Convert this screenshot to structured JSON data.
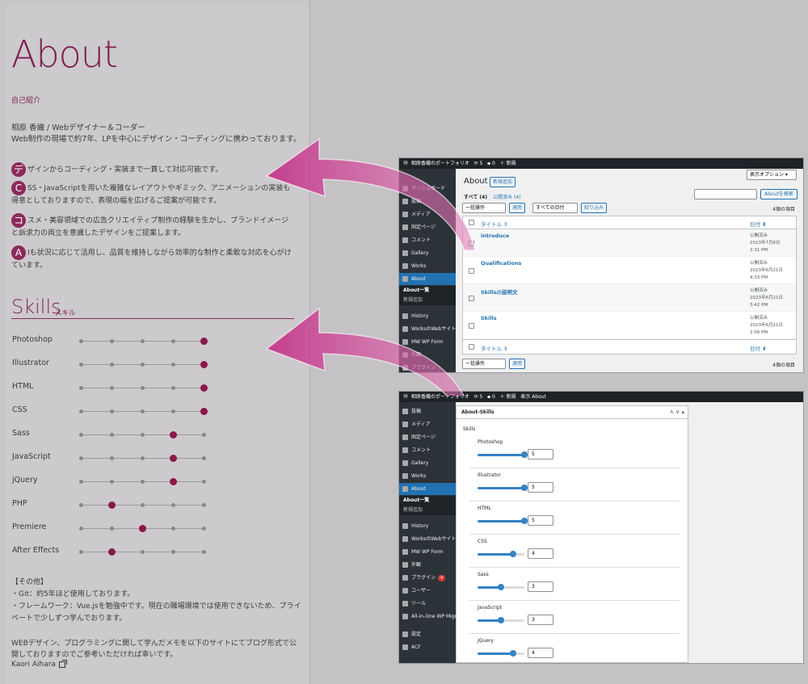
{
  "about": {
    "title": "About",
    "subtitle": "自己紹介",
    "intro_line1": "相原 香織 / Webデザイナー＆コーダー",
    "intro_line2": "Web制作の現場で約7年、LPを中心にデザイン・コーディングに携わっております。",
    "features": [
      {
        "cap": "デ",
        "text": "ザインからコーディング・実装まで一貫して対応可能です。"
      },
      {
        "cap": "C",
        "text": "SS・JavaScriptを用いた複雑なレイアウトやギミック、アニメーションの実装も得意としておりますので、表現の幅を広げるご提案が可能です。"
      },
      {
        "cap": "コ",
        "text": "スメ・美容領域での広告クリエイティブ制作の経験を生かし、ブランドイメージと訴求力の両立を意識したデザインをご提案します。"
      },
      {
        "cap": "A",
        "text": "Iも状況に応じて活用し、品質を維持しながら効率的な制作と柔軟な対応を心がけています。"
      }
    ]
  },
  "skills": {
    "title": "Skills",
    "subtitle": "スキル",
    "items": [
      {
        "name": "Photoshop",
        "level": 5
      },
      {
        "name": "Illustrator",
        "level": 5
      },
      {
        "name": "HTML",
        "level": 5
      },
      {
        "name": "CSS",
        "level": 5
      },
      {
        "name": "Sass",
        "level": 4
      },
      {
        "name": "JavaScript",
        "level": 4
      },
      {
        "name": "jQuery",
        "level": 4
      },
      {
        "name": "PHP",
        "level": 2
      },
      {
        "name": "Premiere",
        "level": 3
      },
      {
        "name": "After Effects",
        "level": 2
      }
    ],
    "max_level": 5
  },
  "other": {
    "heading": "【その他】",
    "lines": [
      "・Git：約5年ほど使用しております。",
      "・フレームワーク：Vue.jsを勉強中です。現在の職場環境では使用できないため、プライベートで少しずつ学んでおります。"
    ],
    "blog_text": "WEBデザイン、プログラミングに関して学んだメモを以下のサイトにてブログ形式で公開しておりますのでご参考いただければ幸いです。",
    "author": "Kaori Aihara"
  },
  "wp_list": {
    "bar_site": "相原香織のポートフォリオ",
    "bar_updates": "5",
    "bar_comments": "0",
    "bar_new": "新規",
    "screen_options": "表示オプション ▾",
    "heading": "About",
    "add_new": "新規追加",
    "filter_all": "すべて (4)",
    "filter_published": "公開済み (4)",
    "search_btn": "Aboutを検索",
    "bulk_action": "一括操作",
    "apply": "適用",
    "all_dates": "すべての日付",
    "filter_btn": "絞り込み",
    "count": "4個の項目",
    "col_title": "タイトル",
    "col_date": "日付",
    "rows": [
      {
        "title": "introduce",
        "status": "公開済み",
        "date": "2023年7月8日",
        "time": "2:31 PM"
      },
      {
        "title": "Qualifications",
        "status": "公開済み",
        "date": "2023年6月21日",
        "time": "4:33 PM"
      },
      {
        "title": "Skillsの説明文",
        "status": "公開済み",
        "date": "2023年6月21日",
        "time": "3:42 PM"
      },
      {
        "title": "Skills",
        "status": "公開済み",
        "date": "2023年6月21日",
        "time": "2:06 PM"
      }
    ],
    "sidebar": [
      "ダッシュボード",
      "投稿",
      "メディア",
      "固定ページ",
      "コメント",
      "Gallery",
      "Works",
      "About",
      "History",
      "WorksのWebサイト",
      "MW WP Form",
      "外観",
      "プラグイン"
    ],
    "submenu": [
      "About一覧",
      "新規追加"
    ]
  },
  "wp_edit": {
    "bar_site": "相原香織のポートフォリオ",
    "bar_updates": "5",
    "bar_comments": "0",
    "bar_new": "新規",
    "bar_view": "表示 About",
    "box_title": "About-Skills",
    "group_label": "Skills",
    "fields": [
      {
        "label": "Photoshop",
        "value": "5"
      },
      {
        "label": "Illustrator",
        "value": "5"
      },
      {
        "label": "HTML",
        "value": "5"
      },
      {
        "label": "CSS",
        "value": "4"
      },
      {
        "label": "Sass",
        "value": "3"
      },
      {
        "label": "JavaScript",
        "value": "3"
      },
      {
        "label": "jQuery",
        "value": "4"
      }
    ],
    "sidebar": [
      "投稿",
      "メディア",
      "固定ページ",
      "コメント",
      "Gallery",
      "Works",
      "About",
      "History",
      "WorksのWebサイト",
      "MW WP Form",
      "外観",
      "プラグイン",
      "ユーザー",
      "ツール",
      "All-in-One WP Migration",
      "設定",
      "ACF"
    ],
    "submenu": [
      "About一覧",
      "新規追加"
    ],
    "plugin_badge": "4"
  },
  "colors": {
    "accent": "#7e1e52",
    "wp_blue": "#2271b1",
    "arrow": "#c2368a"
  }
}
